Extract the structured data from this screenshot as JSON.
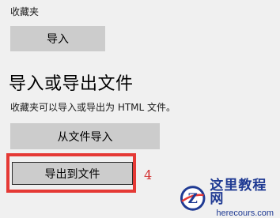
{
  "favorites": {
    "section_label": "收藏夹",
    "import_button": "导入"
  },
  "import_export": {
    "heading": "导入或导出文件",
    "description": "收藏夹可以导入或导出为 HTML 文件。",
    "from_file_button": "从文件导入",
    "export_button": "导出到文件"
  },
  "annotation": {
    "step_number": "4",
    "highlight_color": "#e53935"
  },
  "watermark": {
    "title": "这里教程网",
    "url": "herecours.com",
    "logo_letter": "Z",
    "colors": {
      "primary": "#1f3a93",
      "accent": "#e53935"
    }
  }
}
